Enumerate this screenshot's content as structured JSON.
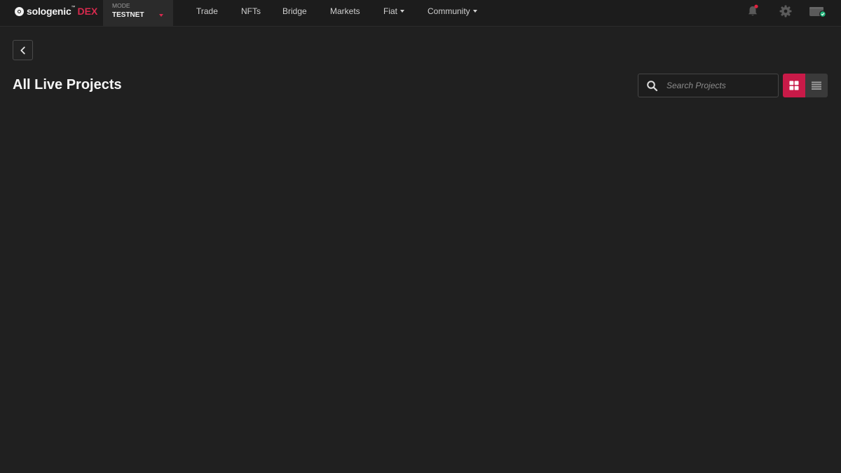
{
  "brand": {
    "name": "sologenic",
    "tm": "™",
    "product": "DEX",
    "accent_color": "#d62a4e"
  },
  "mode": {
    "label": "MODE",
    "value": "TESTNET"
  },
  "nav": {
    "items": [
      {
        "label": "Trade",
        "has_dropdown": false
      },
      {
        "label": "NFTs",
        "has_dropdown": false
      },
      {
        "label": "Bridge",
        "has_dropdown": false
      },
      {
        "label": "Markets",
        "has_dropdown": false
      },
      {
        "label": "Fiat",
        "has_dropdown": true
      },
      {
        "label": "Community",
        "has_dropdown": true
      }
    ]
  },
  "header_icons": {
    "notifications": "bell-icon",
    "settings": "gear-icon",
    "wallet": "wallet-icon",
    "notification_dot_color": "#e0213f",
    "wallet_status_color": "#1fb57a"
  },
  "page": {
    "title": "All Live Projects",
    "back_icon": "chevron-left-icon"
  },
  "search": {
    "placeholder": "Search Projects",
    "value": ""
  },
  "view_toggle": {
    "active": "grid",
    "grid_icon": "grid-icon",
    "list_icon": "list-icon",
    "active_color": "#c81a48"
  }
}
